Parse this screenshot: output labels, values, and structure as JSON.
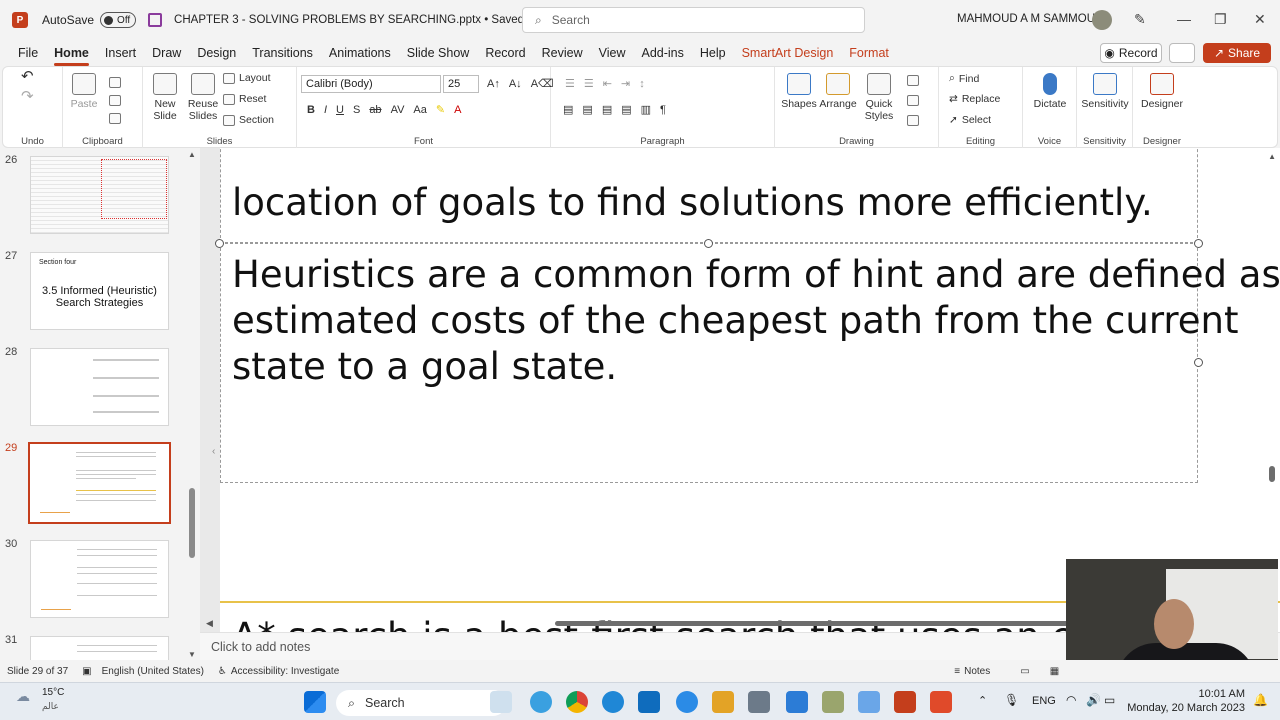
{
  "titlebar": {
    "app_letter": "P",
    "autosave_label": "AutoSave",
    "autosave_state": "Off",
    "document_title": "CHAPTER 3 - SOLVING PROBLEMS BY SEARCHING.pptx • Saved to this PC",
    "search_placeholder": "Search",
    "user_name": "MAHMOUD A M SAMMOUR"
  },
  "menu": {
    "tabs": [
      "File",
      "Home",
      "Insert",
      "Draw",
      "Design",
      "Transitions",
      "Animations",
      "Slide Show",
      "Record",
      "Review",
      "View",
      "Add-ins",
      "Help",
      "SmartArt Design",
      "Format"
    ],
    "active_tab": "Home",
    "record_label": "Record",
    "share_label": "Share"
  },
  "ribbon": {
    "undo_label": "Undo",
    "clipboard": {
      "label": "Clipboard",
      "paste": "Paste"
    },
    "slides": {
      "label": "Slides",
      "new_slide": "New Slide",
      "reuse_slides": "Reuse Slides",
      "layout": "Layout",
      "reset": "Reset",
      "section": "Section"
    },
    "font": {
      "label": "Font",
      "family": "Calibri (Body)",
      "size": "25"
    },
    "paragraph": {
      "label": "Paragraph"
    },
    "drawing": {
      "label": "Drawing",
      "shapes": "Shapes",
      "arrange": "Arrange",
      "quick_styles": "Quick Styles"
    },
    "editing": {
      "label": "Editing",
      "find": "Find",
      "replace": "Replace",
      "select": "Select"
    },
    "voice": {
      "label": "Voice",
      "dictate": "Dictate"
    },
    "sensitivity": {
      "label": "Sensitivity",
      "button": "Sensitivity"
    },
    "designer": {
      "label": "Designer",
      "button": "Designer"
    }
  },
  "thumbnails": [
    {
      "number": "26",
      "caption": ""
    },
    {
      "number": "27",
      "section": "Section four",
      "caption": "3.5 Informed (Heuristic) Search Strategies"
    },
    {
      "number": "28",
      "caption": ""
    },
    {
      "number": "29",
      "caption": ""
    },
    {
      "number": "30",
      "caption": ""
    },
    {
      "number": "31",
      "caption": ""
    }
  ],
  "slide": {
    "text_1": "location of goals to find solutions more efficiently.",
    "text_2_line1": "Heuristics are a common form of hint and are defined as",
    "text_2_line2": "estimated costs of the cheapest path from the current",
    "text_2_line3": "state to a goal state.",
    "text_3": "A* search is a best-first search that uses an evalua"
  },
  "notes_placeholder": "Click to add notes",
  "status": {
    "slide_info": "Slide 29 of 37",
    "language": "English (United States)",
    "accessibility": "Accessibility: Investigate",
    "notes": "Notes"
  },
  "taskbar": {
    "weather_temp": "15°C",
    "weather_sub": "عالم",
    "search": "Search",
    "language": "ENG",
    "time": "10:01 AM",
    "date": "Monday, 20 March 2023"
  }
}
